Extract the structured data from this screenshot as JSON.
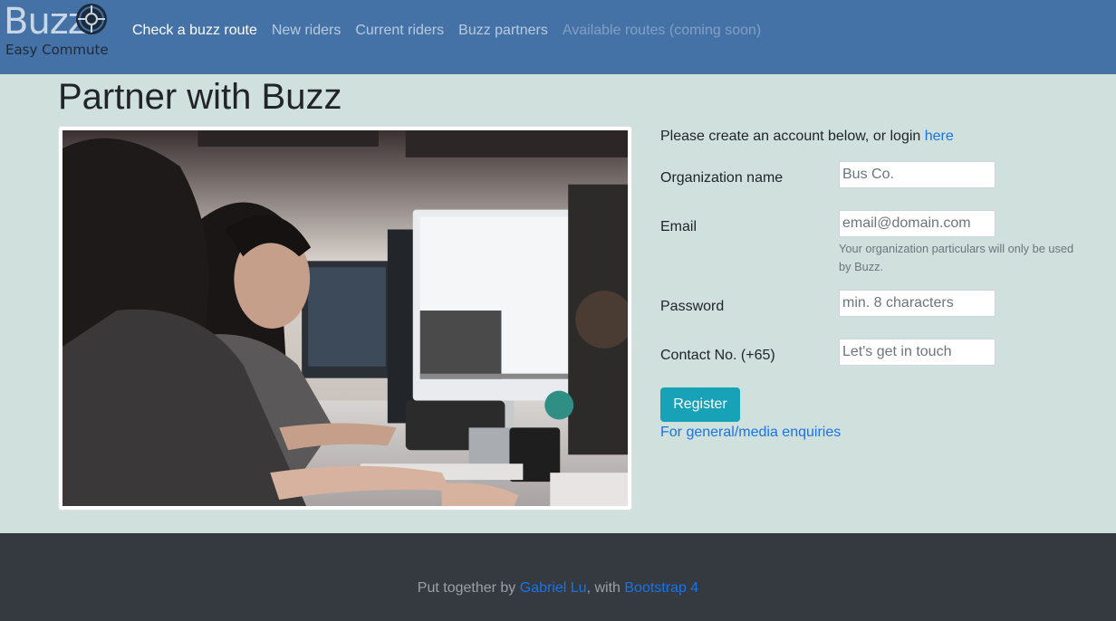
{
  "brand": {
    "name": "Buzz",
    "tagline": "Easy Commute",
    "logo_icon": "compass-wheel-icon"
  },
  "nav": {
    "items": [
      {
        "label": "Check a buzz route",
        "state": "active"
      },
      {
        "label": "New riders",
        "state": "normal"
      },
      {
        "label": "Current riders",
        "state": "normal"
      },
      {
        "label": "Buzz partners",
        "state": "normal"
      },
      {
        "label": "Available routes (coming soon)",
        "state": "disabled"
      }
    ]
  },
  "main": {
    "title": "Partner with Buzz",
    "photo": "photo of two women working at computer monitors in an office"
  },
  "form": {
    "intro_text": "Please create an account below, or login ",
    "intro_link": "here",
    "org_label": "Organization name",
    "org_placeholder": "Bus Co.",
    "email_label": "Email",
    "email_placeholder": "email@domain.com",
    "email_help": "Your organization particulars will only be used by Buzz.",
    "password_label": "Password",
    "password_placeholder": "min. 8 characters",
    "contact_label": "Contact No. (+65)",
    "contact_placeholder": "Let's get in touch",
    "register_label": "Register",
    "enquiries_link": "For general/media enquiries"
  },
  "footer": {
    "prefix": "Put together by ",
    "author": "Gabriel Lu",
    "middle": ", with ",
    "framework": "Bootstrap 4"
  },
  "colors": {
    "navbar_bg": "#4472a7",
    "page_bg": "#d0e0dd",
    "footer_bg": "#343a40",
    "link": "#1a73e8",
    "button": "#17a2b8"
  }
}
